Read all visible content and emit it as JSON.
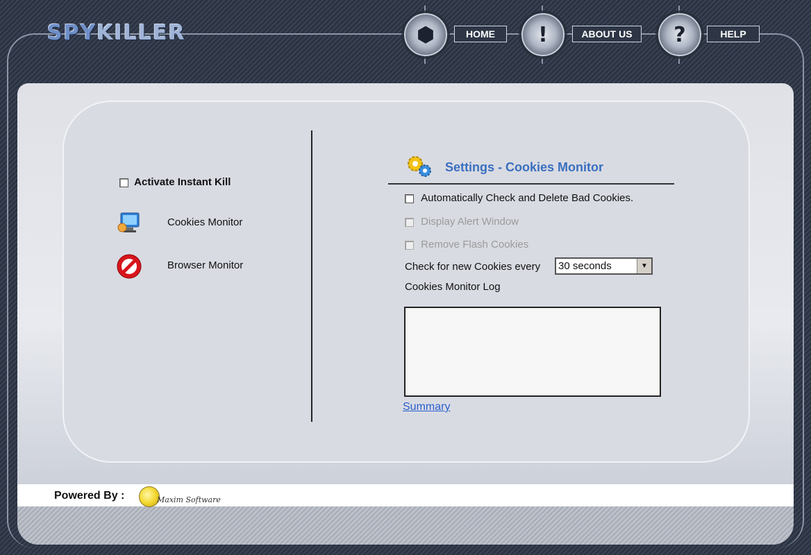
{
  "app": {
    "logo_prefix": "SPY",
    "logo_suffix": "KILLER"
  },
  "nav": {
    "home": "HOME",
    "about": "ABOUT US",
    "help": "HELP"
  },
  "left": {
    "instant_kill_label": "Activate Instant Kill",
    "instant_kill_checked": false,
    "items": [
      {
        "label": "Cookies Monitor",
        "icon": "monitor-icon"
      },
      {
        "label": "Browser Monitor",
        "icon": "stop-sign-icon"
      }
    ]
  },
  "settings": {
    "title": "Settings - Cookies Monitor",
    "auto_check_label": "Automatically Check and Delete Bad Cookies.",
    "auto_check_checked": false,
    "alert_label": "Display Alert Window",
    "alert_enabled": false,
    "flash_label": "Remove Flash Cookies",
    "flash_enabled": false,
    "interval_label": "Check for new Cookies every",
    "interval_value": "30 seconds",
    "log_label": "Cookies Monitor Log",
    "log_content": "",
    "summary_link": "Summary"
  },
  "footer": {
    "powered_by": "Powered By :",
    "vendor": "Maxim Software"
  },
  "colors": {
    "accent": "#3a6fc0",
    "link": "#2a5fd0"
  }
}
